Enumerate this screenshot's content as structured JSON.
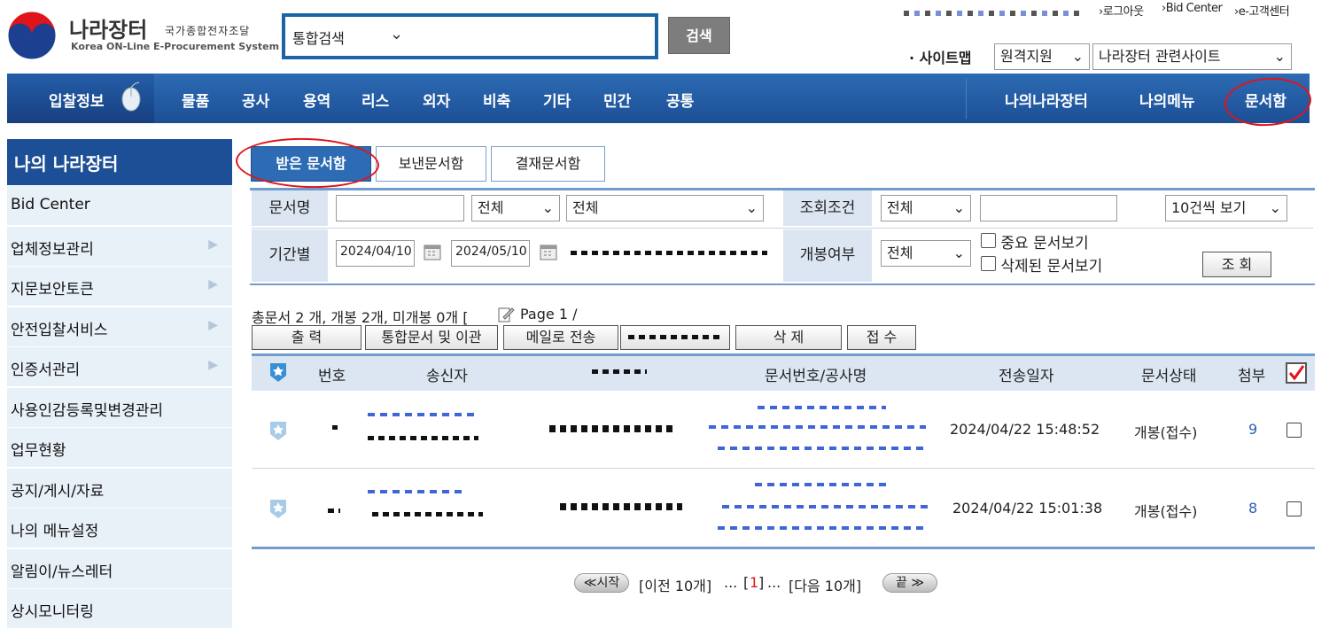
{
  "header": {
    "logo_title": "나라장터",
    "logo_sub_ko": "국가종합전자조달",
    "logo_sub_en": "Korea ON-Line E-Procurement System",
    "search_scope": "통합검색",
    "search_button": "검색",
    "top_links": [
      "›로그아웃",
      "›Bid Center",
      "›e-고객센터"
    ],
    "sitemap": "· 사이트맵",
    "remote_select": "원격지원",
    "related_select": "나라장터 관련사이트"
  },
  "nav": {
    "first": "입찰정보",
    "items": [
      "물품",
      "공사",
      "용역",
      "리스",
      "외자",
      "비축",
      "기타",
      "민간",
      "공통"
    ],
    "right": [
      "나의나라장터",
      "나의메뉴",
      "문서함"
    ]
  },
  "sidebar": {
    "title": "나의 나라장터",
    "items": [
      {
        "label": "Bid Center",
        "arrow": false
      },
      {
        "label": "업체정보관리",
        "arrow": true
      },
      {
        "label": "지문보안토큰",
        "arrow": true
      },
      {
        "label": "안전입찰서비스",
        "arrow": true
      },
      {
        "label": "인증서관리",
        "arrow": true
      },
      {
        "label": "사용인감등록및변경관리",
        "arrow": false
      },
      {
        "label": "업무현황",
        "arrow": false
      },
      {
        "label": "공지/게시/자료",
        "arrow": false
      },
      {
        "label": "나의 메뉴설정",
        "arrow": false
      },
      {
        "label": "알림이/뉴스레터",
        "arrow": false
      },
      {
        "label": "상시모니터링",
        "arrow": false
      }
    ]
  },
  "tabs": [
    "받은 문서함",
    "보낸문서함",
    "결재문서함"
  ],
  "filter": {
    "doc_name_label": "문서명",
    "doc_type1": "전체",
    "doc_type2": "전체",
    "cond_label": "조회조건",
    "cond_value": "전체",
    "page_size": "10건씩 보기",
    "period_label": "기간별",
    "date_from": "2024/04/10",
    "date_to": "2024/05/10",
    "open_label": "개봉여부",
    "open_value": "전체",
    "check_important": "중요 문서보기",
    "check_deleted": "삭제된 문서보기",
    "search_button": "조 회"
  },
  "summary": "총문서 2 개, 개봉 2개, 미개봉 0개 [",
  "page_indicator": "Page 1 /",
  "actions": [
    "출 력",
    "통합문서 및 이관",
    "메일로 전송",
    "삭 제",
    "접 수"
  ],
  "table": {
    "headers": [
      "번호",
      "송신자",
      "문서번호/공사명",
      "전송일자",
      "문서상태",
      "첨부"
    ],
    "rows": [
      {
        "date": "2024/04/22 15:48:52",
        "status": "개봉(접수)",
        "attach": "9"
      },
      {
        "date": "2024/04/22 15:01:38",
        "status": "개봉(접수)",
        "attach": "8"
      }
    ]
  },
  "pager": {
    "first": "≪시작",
    "prev": "[이전 10개]",
    "ellipsis1": "...",
    "open_bracket": "[",
    "current": "1",
    "close_bracket": "]",
    "ellipsis2": "...",
    "next": "[다음 10개]",
    "last": "끝 ≫"
  },
  "colors": {
    "brand_blue": "#1c4f96",
    "accent_red": "#e0141b"
  }
}
